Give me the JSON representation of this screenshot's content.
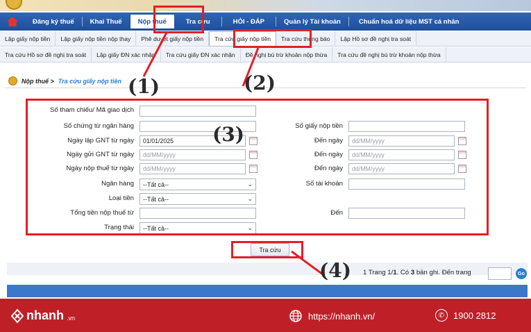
{
  "main_nav": {
    "items": [
      "Đăng ký thuế",
      "Khai Thuế",
      "Nộp thuế",
      "Tra cứu",
      "HỎI - ĐÁP",
      "Quản lý Tài khoản",
      "Chuẩn hoá dữ liệu MST cá nhân"
    ],
    "active": "Nộp thuế"
  },
  "sub_nav_row1": [
    "Lập giấy nộp tiền",
    "Lập giấy nộp tiền nộp thay",
    "Phê duyệt giấy nộp tiền",
    "Tra cứu giấy nộp tiền",
    "Tra cứu thông báo",
    "Lập Hồ sơ đề nghị tra soát"
  ],
  "sub_nav_row2": [
    "Tra cứu Hồ sơ đề nghị tra soát",
    "Lập giấy ĐN xác nhận",
    "Tra cứu giấy ĐN xác nhận",
    "Đề nghị bù trừ khoản nộp thừa",
    "Tra cứu đề nghị bù trừ khoản nộp thừa"
  ],
  "breadcrumb": {
    "parent": "Nộp thuế >",
    "current": "Tra cứu giấy nộp tiền"
  },
  "form": {
    "ref_label": "Số tham chiếu/ Mã giao dịch",
    "bank_doc_label": "Số chứng từ ngân hàng",
    "gnt_no_label": "Số giấy nộp tiền",
    "created_from_label": "Ngày lập GNT từ ngày",
    "created_from_value": "01/01/2025",
    "sent_from_label": "Ngày gửi GNT từ ngày",
    "paid_from_label": "Ngày nộp thuế từ ngày",
    "to_label": "Đến ngày",
    "date_placeholder": "dd/MM/yyyy",
    "bank_label": "Ngân hàng",
    "account_label": "Số tài khoản",
    "money_type_label": "Loại tiền",
    "total_from_label": "Tổng tiền nộp thuế từ",
    "total_to_label": "Đến",
    "status_label": "Trạng thái",
    "all_option": "--Tất cả--"
  },
  "search_button": "Tra cứu",
  "pager": {
    "prefix": "1  Trang 1/",
    "pages": "1",
    "mid": ". Có ",
    "count": "3",
    "suffix": " bản ghi. Đến trang",
    "go": "Go"
  },
  "annotations": [
    "(1)",
    "(2)",
    "(3)",
    "(4)"
  ],
  "footer": {
    "brand": "nhanh",
    "brand_suffix": ".vn",
    "url": "https://nhanh.vn/",
    "phone": "1900 2812"
  },
  "colors": {
    "nav_blue": "#1e4f9c",
    "annotation_red": "#e21f26",
    "footer_red": "#bf2028"
  }
}
